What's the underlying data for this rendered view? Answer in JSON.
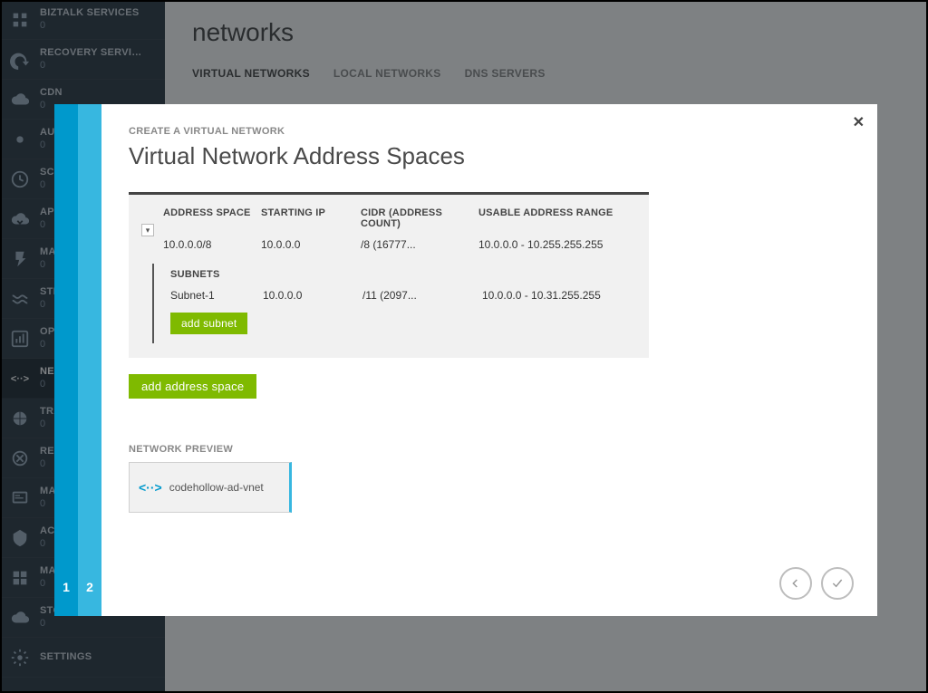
{
  "sidebar": {
    "items": [
      {
        "label": "BIZTALK SERVICES",
        "count": "0",
        "icon": "biztalk"
      },
      {
        "label": "RECOVERY SERVICES",
        "count": "0",
        "icon": "recovery"
      },
      {
        "label": "CDN",
        "count": "0",
        "icon": "cdn"
      },
      {
        "label": "AUTOMATION",
        "count": "0",
        "icon": "automation"
      },
      {
        "label": "SCHEDULER",
        "count": "0",
        "icon": "scheduler"
      },
      {
        "label": "API MANAGEMENT",
        "count": "0",
        "icon": "api"
      },
      {
        "label": "MACHINE LEARNING",
        "count": "0",
        "icon": "ml"
      },
      {
        "label": "STREAM ANALYTICS",
        "count": "0",
        "icon": "stream"
      },
      {
        "label": "OPERATIONAL INSIGHTS",
        "count": "0",
        "icon": "opinsights"
      },
      {
        "label": "NETWORKS",
        "count": "0",
        "icon": "networks",
        "selected": true
      },
      {
        "label": "TRAFFIC MANAGER",
        "count": "0",
        "icon": "traffic"
      },
      {
        "label": "REMOTEAPP",
        "count": "0",
        "icon": "remoteapp"
      },
      {
        "label": "MANAGEMENT SERVICES",
        "count": "0",
        "icon": "mgmt"
      },
      {
        "label": "ACTIVE DIRECTORY",
        "count": "0",
        "icon": "ad"
      },
      {
        "label": "MARKETPLACE",
        "count": "0",
        "icon": "marketplace"
      },
      {
        "label": "STORSIMPLE",
        "count": "0",
        "icon": "storsimple"
      },
      {
        "label": "SETTINGS",
        "count": "",
        "icon": "settings"
      }
    ]
  },
  "stage": {
    "title": "networks",
    "tabs": [
      "VIRTUAL NETWORKS",
      "LOCAL NETWORKS",
      "DNS SERVERS"
    ],
    "active_tab": "VIRTUAL NETWORKS"
  },
  "wizard": {
    "steps_numbers": [
      "1",
      "2"
    ],
    "breadcrumb": "CREATE A VIRTUAL NETWORK",
    "title": "Virtual Network Address Spaces",
    "table": {
      "headers": {
        "space": "ADDRESS SPACE",
        "starting": "STARTING IP",
        "cidr": "CIDR (ADDRESS COUNT)",
        "range": "USABLE ADDRESS RANGE"
      },
      "row": {
        "space": "10.0.0.0/8",
        "starting": "10.0.0.0",
        "cidr": "/8 (16777...",
        "range": "10.0.0.0 - 10.255.255.255"
      },
      "subnets_header": "SUBNETS",
      "subnet": {
        "name": "Subnet-1",
        "starting": "10.0.0.0",
        "cidr": "/11 (2097...",
        "range": "10.0.0.0 - 10.31.255.255"
      },
      "add_subnet_label": "add subnet",
      "add_space_label": "add address space"
    },
    "preview_label": "NETWORK PREVIEW",
    "preview_name": "codehollow-ad-vnet"
  }
}
